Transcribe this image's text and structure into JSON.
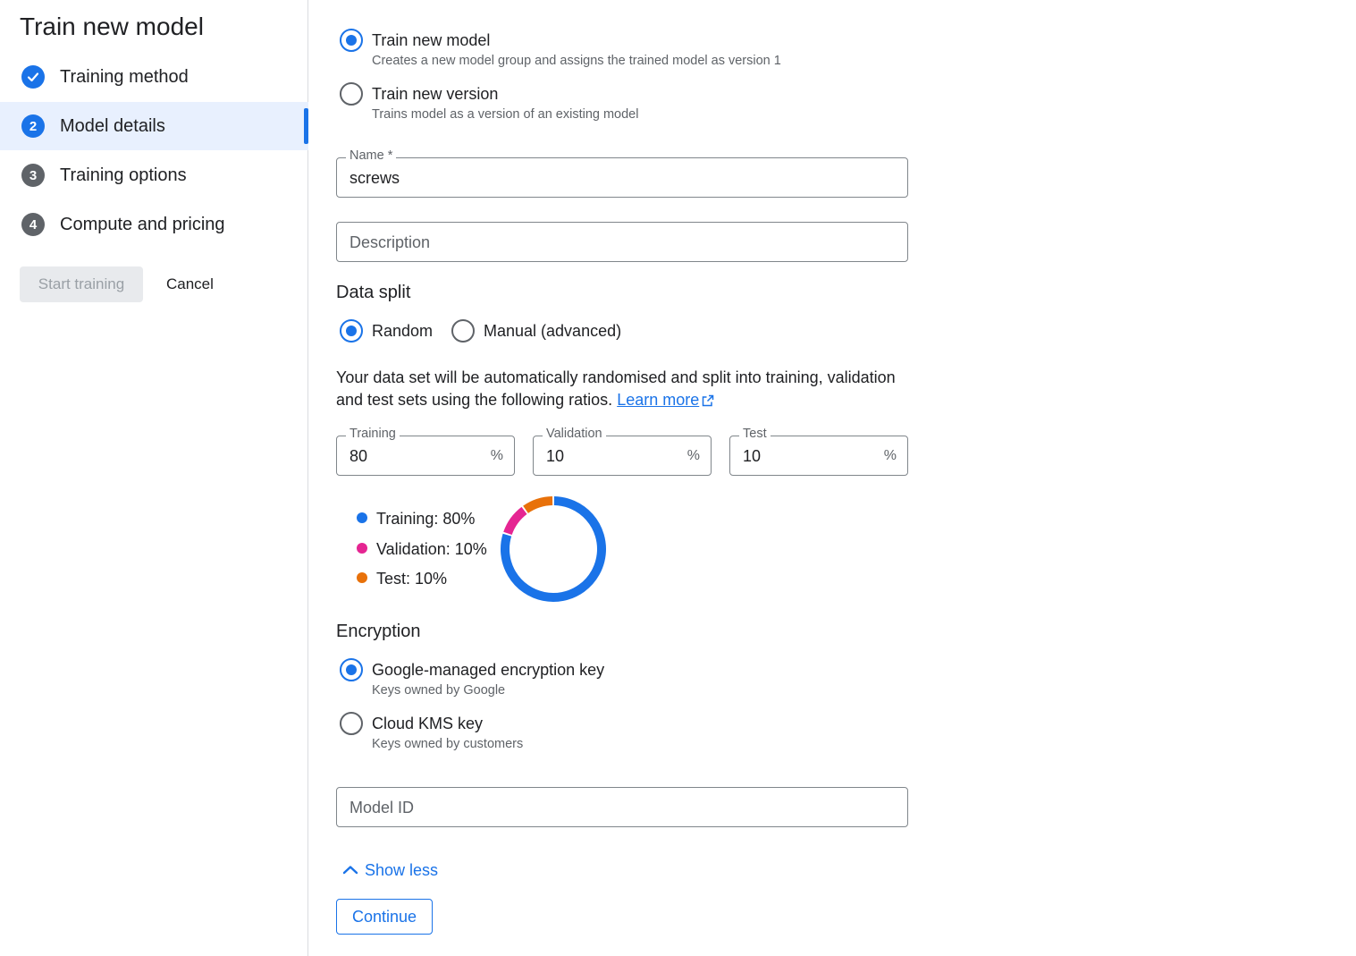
{
  "sidebar": {
    "title": "Train new model",
    "steps": [
      {
        "number": "",
        "label": "Training method",
        "state": "done"
      },
      {
        "number": "2",
        "label": "Model details",
        "state": "current"
      },
      {
        "number": "3",
        "label": "Training options",
        "state": "todo"
      },
      {
        "number": "4",
        "label": "Compute and pricing",
        "state": "todo"
      }
    ],
    "start_training_label": "Start training",
    "cancel_label": "Cancel"
  },
  "training_type": {
    "options": [
      {
        "label": "Train new model",
        "description": "Creates a new model group and assigns the trained model as version 1",
        "selected": true
      },
      {
        "label": "Train new version",
        "description": "Trains model as a version of an existing model",
        "selected": false
      }
    ]
  },
  "name_field": {
    "label": "Name *",
    "value": "screws"
  },
  "description_field": {
    "placeholder": "Description"
  },
  "data_split": {
    "title": "Data split",
    "options": [
      {
        "label": "Random",
        "selected": true
      },
      {
        "label": "Manual (advanced)",
        "selected": false
      }
    ],
    "description": "Your data set will be automatically randomised and split into training, validation and test sets using the following ratios.",
    "learn_more": "Learn more",
    "fields": [
      {
        "label": "Training",
        "value": "80",
        "suffix": "%"
      },
      {
        "label": "Validation",
        "value": "10",
        "suffix": "%"
      },
      {
        "label": "Test",
        "value": "10",
        "suffix": "%"
      }
    ],
    "legend": [
      {
        "label": "Training: 80%",
        "color": "#1a73e8"
      },
      {
        "label": "Validation: 10%",
        "color": "#e52592"
      },
      {
        "label": "Test: 10%",
        "color": "#e8710a"
      }
    ]
  },
  "chart_data": {
    "type": "pie",
    "categories": [
      "Training",
      "Validation",
      "Test"
    ],
    "values": [
      80,
      10,
      10
    ],
    "colors": [
      "#1a73e8",
      "#e52592",
      "#e8710a"
    ]
  },
  "encryption": {
    "title": "Encryption",
    "options": [
      {
        "label": "Google-managed encryption key",
        "description": "Keys owned by Google",
        "selected": true
      },
      {
        "label": "Cloud KMS key",
        "description": "Keys owned by customers",
        "selected": false
      }
    ]
  },
  "model_id_field": {
    "placeholder": "Model ID"
  },
  "show_less_label": "Show less",
  "continue_label": "Continue"
}
